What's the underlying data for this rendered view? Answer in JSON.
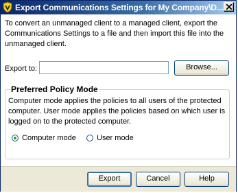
{
  "window": {
    "title": "Export Communications Settings for My Company\\D...",
    "close_glyph": "✕"
  },
  "body": {
    "description": "To convert an unmanaged client to a managed client, export the Communications Settings to a file and then import this file into the unmanaged client.",
    "export_label": "Export to:",
    "export_value": "",
    "browse_label": "Browse..."
  },
  "policy_group": {
    "title": "Preferred Policy Mode",
    "description": "Computer mode applies the policies to all users of the protected computer. User mode applies the policies based on which user is logged on to the protected computer.",
    "options": [
      {
        "label": "Computer mode",
        "checked": true
      },
      {
        "label": "User mode",
        "checked": false
      }
    ]
  },
  "footer": {
    "export_label": "Export",
    "cancel_label": "Cancel",
    "help_label": "Help"
  }
}
